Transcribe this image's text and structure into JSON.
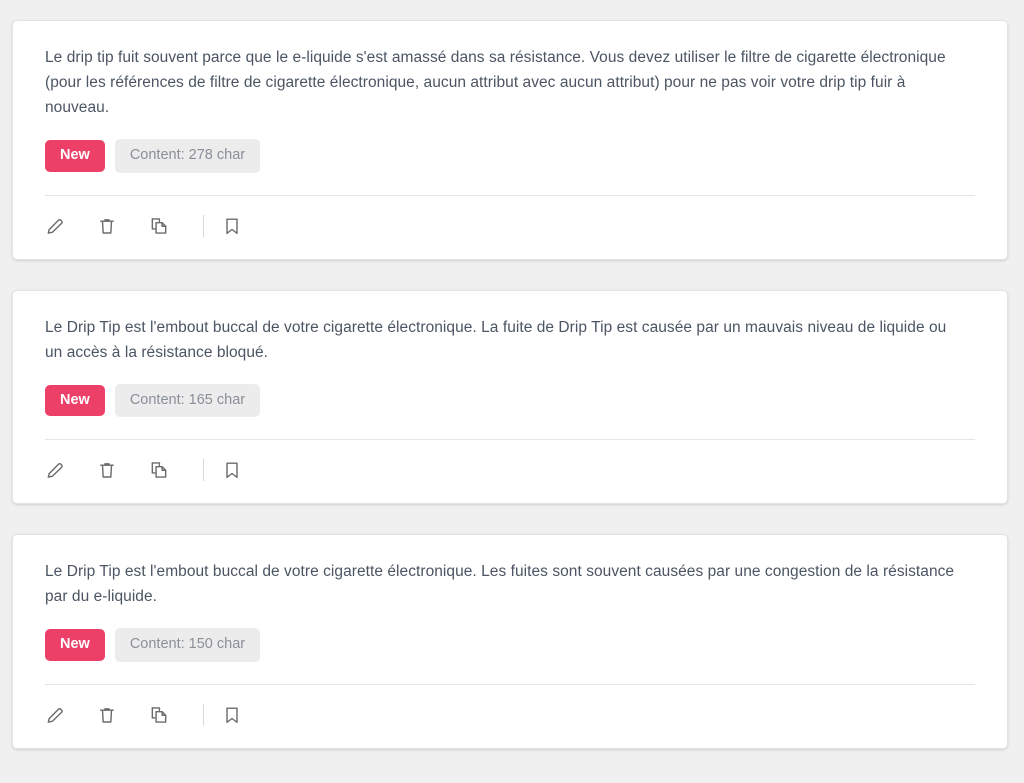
{
  "theme": {
    "page_background": "#f0f0f0",
    "card_background": "#ffffff",
    "badge_new_color": "#ec4069",
    "badge_content_background": "#ececec",
    "text_color": "#4b5563"
  },
  "actions": {
    "edit_label": "edit-icon",
    "delete_label": "trash-icon",
    "copy_label": "copy-icon",
    "bookmark_label": "bookmark-icon"
  },
  "cards": [
    {
      "text": "Le drip tip fuit souvent parce que le e-liquide s'est amassé dans sa résistance. Vous devez utiliser le filtre de cigarette électronique (pour les références de filtre de cigarette électronique, aucun attribut avec aucun attribut) pour ne pas voir votre drip tip fuir à nouveau.",
      "status_badge": "New",
      "content_badge": "Content: 278 char"
    },
    {
      "text": "Le Drip Tip est l'embout buccal de votre cigarette électronique. La fuite de Drip Tip est causée par un mauvais niveau de liquide ou un accès à la résistance bloqué.",
      "status_badge": "New",
      "content_badge": "Content: 165 char"
    },
    {
      "text": "Le Drip Tip est l'embout buccal de votre cigarette électronique. Les fuites sont souvent causées par une congestion de la résistance par du e-liquide.",
      "status_badge": "New",
      "content_badge": "Content: 150 char"
    }
  ]
}
